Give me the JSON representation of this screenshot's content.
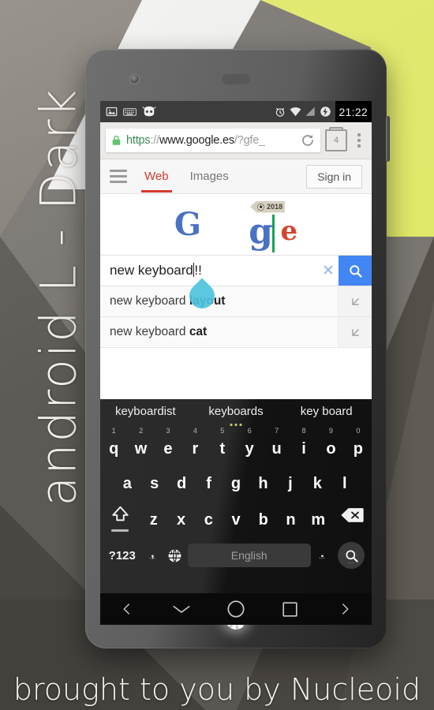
{
  "wallpaper": {
    "vertical_title": "android L - Dark",
    "tagline": "brought to you by Nucleoid",
    "accent_yellow": "#dfe869",
    "accent_white": "#f4f4f2"
  },
  "statusbar": {
    "time": "21:22",
    "left_icons": [
      "screenshot-icon",
      "keyboard-icon",
      "cyanogenmod-icon"
    ],
    "right_icons": [
      "alarm-icon",
      "wifi-icon",
      "signal-icon",
      "battery-charging-icon"
    ]
  },
  "browser": {
    "url_scheme": "https",
    "url_separator": "://",
    "url_domain": "www.google.es",
    "url_rest": "/?gfe_",
    "lock_icon": "lock-icon",
    "reload_icon": "reload-icon",
    "tab_count": "4",
    "menu_icon": "overflow-menu-icon"
  },
  "google_header": {
    "menu_icon": "hamburger-icon",
    "tabs": [
      {
        "label": "Web",
        "active": true
      },
      {
        "label": "Images",
        "active": false
      }
    ],
    "sign_in_label": "Sign in"
  },
  "logo": {
    "left_letter": "G",
    "doodle_g": "g",
    "doodle_e": "e",
    "doodle_sign_text": "2018",
    "doodle_name": "world-cup-2018-doodle"
  },
  "search": {
    "typed_text": "new keyboard",
    "trailing_text": "!!",
    "placeholder": "Search",
    "clear_icon": "clear-x-icon",
    "search_icon": "search-icon",
    "suggestions": [
      {
        "prefix": "new keyboard ",
        "bold": "layout",
        "insert_icon": "insert-arrow-icon"
      },
      {
        "prefix": "new keyboard ",
        "bold": "cat",
        "insert_icon": "insert-arrow-icon"
      }
    ]
  },
  "keyboard": {
    "suggestions": [
      "keyboardist",
      "keyboards",
      "key board"
    ],
    "active_suggestion_index": 1,
    "row1": [
      {
        "ch": "q",
        "num": "1"
      },
      {
        "ch": "w",
        "num": "2"
      },
      {
        "ch": "e",
        "num": "3"
      },
      {
        "ch": "r",
        "num": "4"
      },
      {
        "ch": "t",
        "num": "5"
      },
      {
        "ch": "y",
        "num": "6"
      },
      {
        "ch": "u",
        "num": "7"
      },
      {
        "ch": "i",
        "num": "8"
      },
      {
        "ch": "o",
        "num": "9"
      },
      {
        "ch": "p",
        "num": "0"
      }
    ],
    "row2": [
      "a",
      "s",
      "d",
      "f",
      "g",
      "h",
      "j",
      "k",
      "l"
    ],
    "row3": [
      "z",
      "x",
      "c",
      "v",
      "b",
      "n",
      "m"
    ],
    "shift_icon": "shift-icon",
    "backspace_icon": "backspace-icon",
    "symbols_label": "?123",
    "comma_label": ",",
    "globe_icon": "language-globe-icon",
    "space_label": "English",
    "period_label": ".",
    "enter_icon": "search-enter-icon"
  },
  "navbar": {
    "buttons": [
      {
        "name": "back-chevron-icon"
      },
      {
        "name": "hide-keyboard-icon"
      },
      {
        "name": "home-circle-icon"
      },
      {
        "name": "recents-square-icon"
      },
      {
        "name": "forward-chevron-icon"
      }
    ]
  },
  "phone": {
    "camera_icon": "front-camera",
    "home_logo": "nucleoid-swirl-logo"
  }
}
